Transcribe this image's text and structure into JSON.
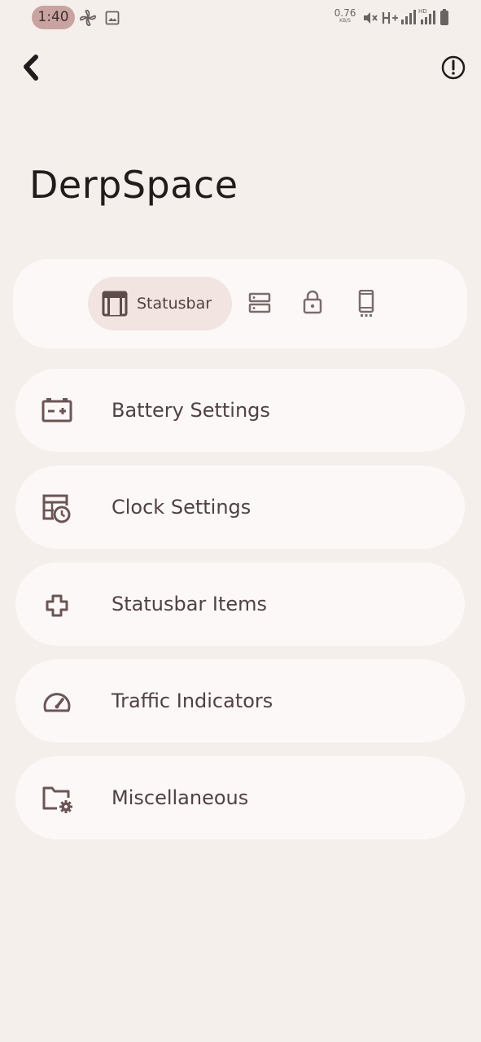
{
  "status_bar": {
    "time": "1:40",
    "net_speed_value": "0.76",
    "net_speed_unit": "KB/S",
    "icons": [
      "fan-icon",
      "image-icon",
      "mute-icon",
      "hplus-icon",
      "signal-icon",
      "hd-signal-icon",
      "battery-icon"
    ]
  },
  "header": {
    "title": "DerpSpace",
    "back_icon": "chevron-left-icon",
    "info_icon": "info-icon"
  },
  "tabs": {
    "active_label": "Statusbar",
    "items": [
      "statusbar-icon",
      "quick-settings-icon",
      "lock-icon",
      "phone-icon"
    ]
  },
  "menu": [
    {
      "label": "Battery Settings",
      "icon": "battery-plus-icon"
    },
    {
      "label": "Clock Settings",
      "icon": "clock-calendar-icon"
    },
    {
      "label": "Statusbar Items",
      "icon": "plus-outline-icon"
    },
    {
      "label": "Traffic Indicators",
      "icon": "speedometer-icon"
    },
    {
      "label": "Miscellaneous",
      "icon": "folder-gear-icon"
    }
  ],
  "colors": {
    "background": "#f5efec",
    "card": "#fdf8f8",
    "active_tab": "#f1e4e1",
    "accent_pill": "#c9a3a0",
    "text": "#4f4242",
    "title": "#221b1b"
  }
}
